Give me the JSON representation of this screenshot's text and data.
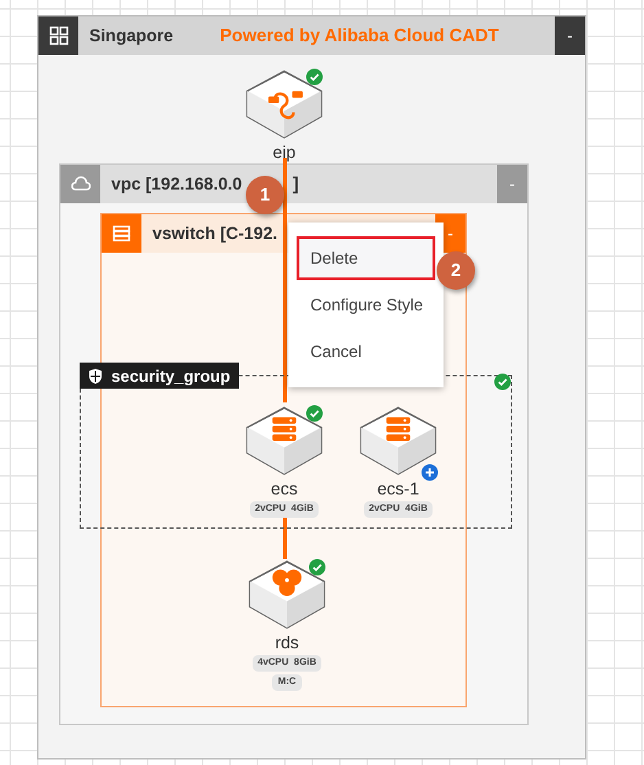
{
  "region": {
    "title": "Singapore",
    "brand": "Powered by Alibaba Cloud CADT",
    "collapse": "-"
  },
  "vpc": {
    "title": "vpc [192.168.0.0",
    "title_end": "]",
    "collapse": "-"
  },
  "vswitch": {
    "title": "vswitch [C-192.",
    "collapse": "-"
  },
  "security_group": {
    "title": "security_group",
    "healthy": true
  },
  "nodes": [
    {
      "kind": "eip",
      "label": "eip",
      "healthy": true,
      "added": false
    },
    {
      "kind": "ecs",
      "label": "ecs",
      "healthy": true,
      "added": false,
      "tags": [
        "2vCPU  4GiB"
      ]
    },
    {
      "kind": "ecs",
      "label": "ecs-1",
      "healthy": false,
      "added": true,
      "tags": [
        "2vCPU  4GiB"
      ]
    },
    {
      "kind": "rds",
      "label": "rds",
      "healthy": true,
      "added": false,
      "tags": [
        "4vCPU  8GiB",
        "M:C"
      ]
    }
  ],
  "context_menu": [
    {
      "label": "Delete",
      "highlighted": true
    },
    {
      "label": "Configure Style",
      "highlighted": false
    },
    {
      "label": "Cancel",
      "highlighted": false
    }
  ],
  "callouts": [
    "1",
    "2"
  ]
}
